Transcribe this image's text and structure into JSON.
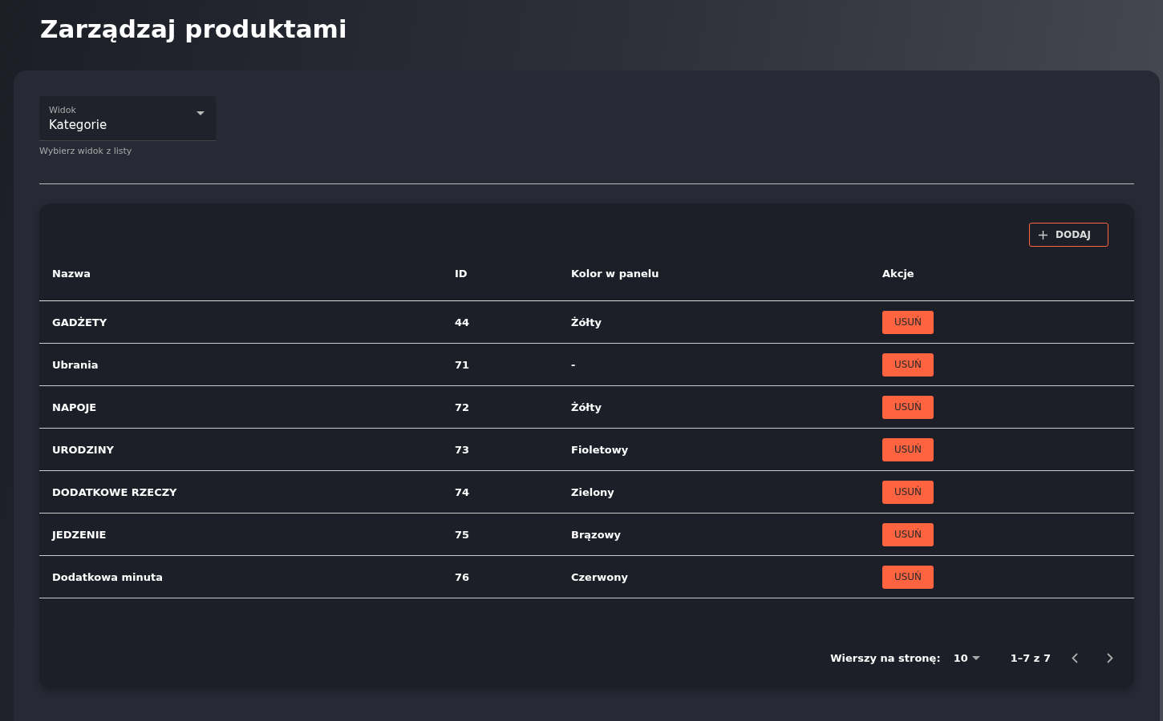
{
  "page_title": "Zarządzaj produktami",
  "view_select": {
    "label": "Widok",
    "value": "Kategorie",
    "helper": "Wybierz widok z listy"
  },
  "add_button": {
    "label": "DODAJ"
  },
  "table": {
    "columns": [
      "Nazwa",
      "ID",
      "Kolor w panelu",
      "Akcje"
    ],
    "rows": [
      {
        "name": "GADŻETY",
        "id": "44",
        "color_name": "Żółty",
        "action": "USUŃ"
      },
      {
        "name": "Ubrania",
        "id": "71",
        "color_name": "-",
        "action": "USUŃ"
      },
      {
        "name": "NAPOJE",
        "id": "72",
        "color_name": "Żółty",
        "action": "USUŃ"
      },
      {
        "name": "URODZINY",
        "id": "73",
        "color_name": "Fioletowy",
        "action": "USUŃ"
      },
      {
        "name": "DODATKOWE RZECZY",
        "id": "74",
        "color_name": "Zielony",
        "action": "USUŃ"
      },
      {
        "name": "JEDZENIE",
        "id": "75",
        "color_name": "Brązowy",
        "action": "USUŃ"
      },
      {
        "name": "Dodatkowa minuta",
        "id": "76",
        "color_name": "Czerwony",
        "action": "USUŃ"
      }
    ]
  },
  "pagination": {
    "rows_per_page_label": "Wierszy na stronę:",
    "rows_per_page": "10",
    "range": "1–7 z 7"
  }
}
